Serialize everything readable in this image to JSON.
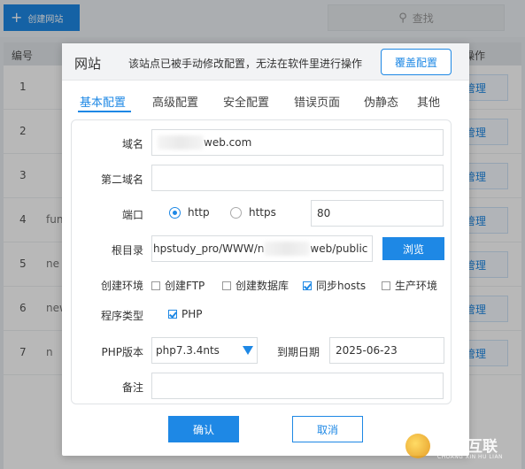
{
  "background": {
    "create_button": "创建网站",
    "search_label": "查找",
    "table_headers": {
      "number": "编号",
      "actions": "操作"
    },
    "rows": [
      {
        "num": "1",
        "name": "",
        "action": "管理"
      },
      {
        "num": "2",
        "name": "",
        "action": "管理"
      },
      {
        "num": "3",
        "name": "",
        "action": "管理"
      },
      {
        "num": "4",
        "name": "fun",
        "action": "管理"
      },
      {
        "num": "5",
        "name": "ne",
        "action": "管理"
      },
      {
        "num": "6",
        "name": "new",
        "action": "管理"
      },
      {
        "num": "7",
        "name": "n",
        "action": "管理"
      }
    ]
  },
  "dialog": {
    "title": "网站",
    "notice": "该站点已被手动修改配置，无法在软件里进行操作",
    "override_button": "覆盖配置",
    "tabs": [
      "基本配置",
      "高级配置",
      "安全配置",
      "错误页面",
      "伪静态",
      "其他"
    ],
    "active_tab": 0,
    "form": {
      "domain_label": "域名",
      "domain_value": "web.com",
      "domain2_label": "第二域名",
      "domain2_value": "",
      "port_label": "端口",
      "protocols": [
        {
          "label": "http",
          "selected": true
        },
        {
          "label": "https",
          "selected": false
        }
      ],
      "port_value": "80",
      "root_label": "根目录",
      "root_prefix": "hpstudy_pro/WWW/n",
      "root_suffix": "web/public",
      "browse_button": "浏览",
      "env_label": "创建环境",
      "env_options": [
        {
          "label": "创建FTP",
          "checked": false
        },
        {
          "label": "创建数据库",
          "checked": false
        },
        {
          "label": "同步hosts",
          "checked": true
        },
        {
          "label": "生产环境",
          "checked": false
        }
      ],
      "program_label": "程序类型",
      "program_option": {
        "label": "PHP",
        "checked": true
      },
      "php_label": "PHP版本",
      "php_value": "php7.3.4nts",
      "expire_label": "到期日期",
      "expire_value": "2025-06-23",
      "note_label": "备注",
      "note_value": ""
    },
    "confirm_button": "确认",
    "cancel_button": "取消"
  },
  "watermark": {
    "text": "创新互联",
    "sub": "CHUANG XIN HU LIAN"
  },
  "colors": {
    "accent": "#1e88e5"
  }
}
